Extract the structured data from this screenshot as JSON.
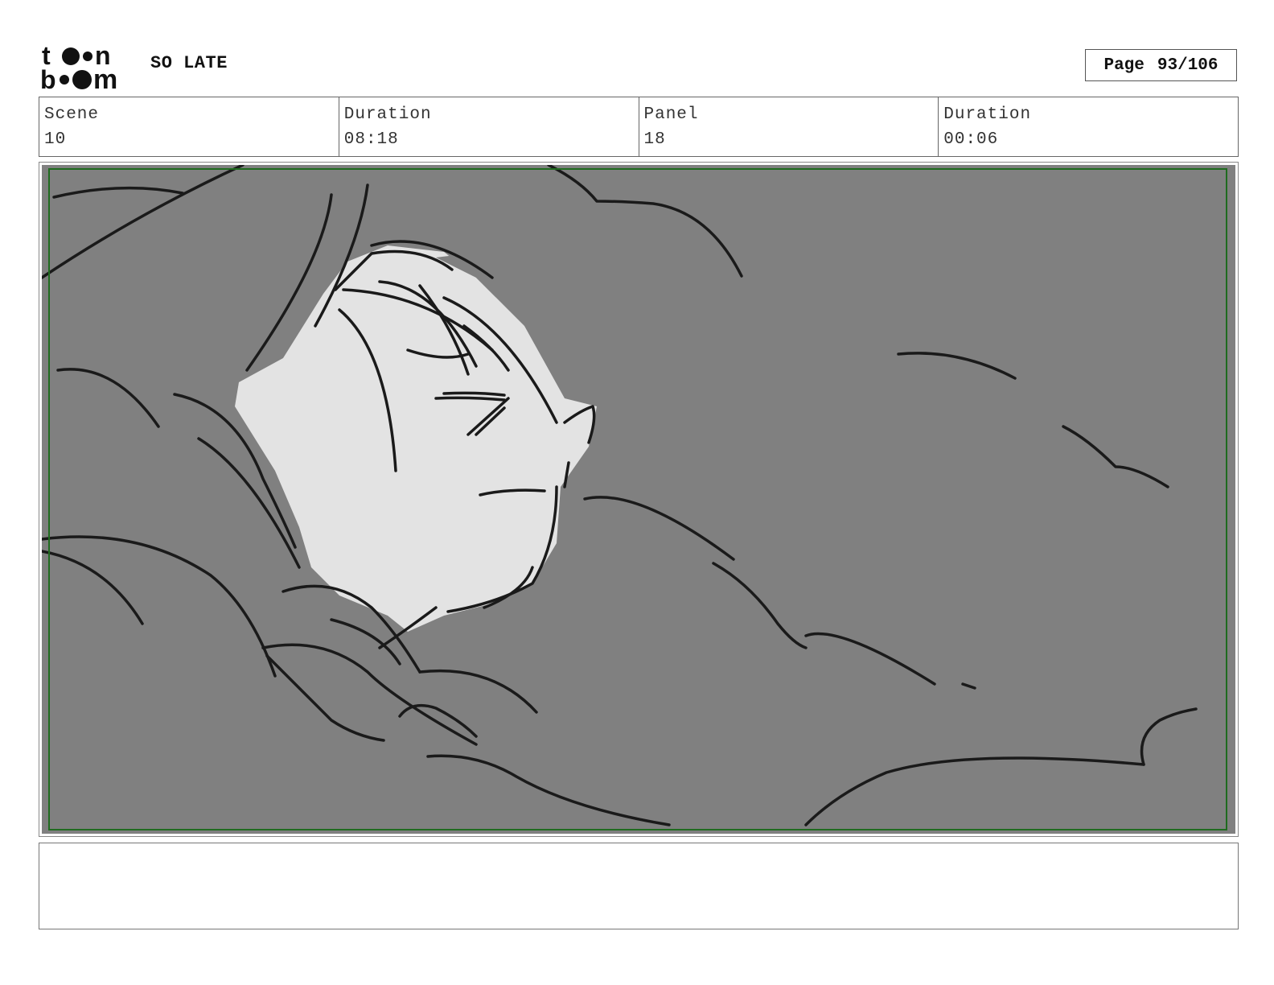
{
  "header": {
    "logo_icon": "toonboom-logo-icon",
    "title": "SO LATE",
    "page_label": "Page",
    "page_number": "93/106"
  },
  "info": {
    "scene_label": "Scene",
    "scene_value": "10",
    "scene_duration_label": "Duration",
    "scene_duration_value": "08:18",
    "panel_label": "Panel",
    "panel_value": "18",
    "panel_duration_label": "Duration",
    "panel_duration_value": "00:06"
  },
  "panel": {
    "image_icon": "storyboard-sketch-image",
    "background_color": "#808080",
    "face_color": "#e3e3e3",
    "safe_frame_color": "#1f6b1f"
  },
  "notes": {
    "text": ""
  }
}
